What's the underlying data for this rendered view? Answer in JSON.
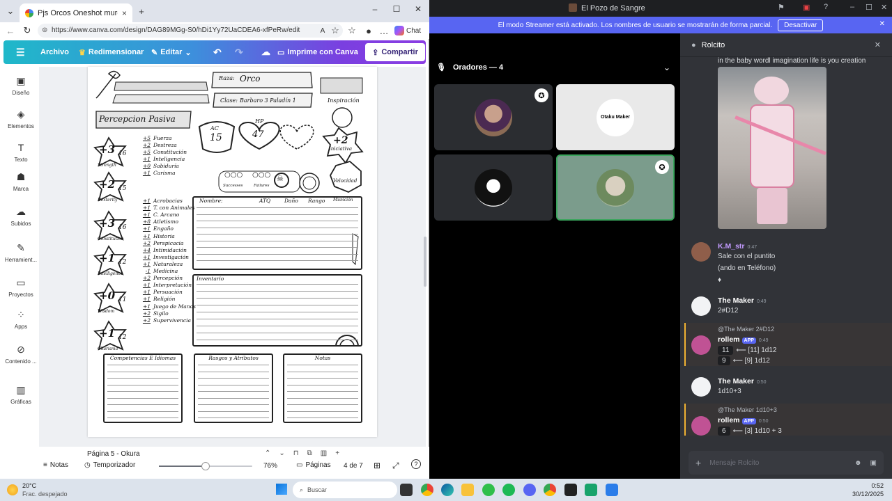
{
  "browser": {
    "tab_title": "Pjs Orcos Oneshot murder hobo -",
    "tab_close": "×",
    "new_tab": "+",
    "url": "https://www.canva.com/design/DAG89MGg-S0/hDi1Yy72UaCDEA6-xfPeRw/edit",
    "chat_label": "Chat"
  },
  "canva_toolbar": {
    "menu": "☰",
    "archivo": "Archivo",
    "redimensionar": "Redimensionar",
    "editar": "Editar",
    "imprime": "Imprime con Canva",
    "compartir": "Compartir"
  },
  "left_rail": [
    {
      "label": "Diseño",
      "icon": "▣"
    },
    {
      "label": "Elementos",
      "icon": "◈"
    },
    {
      "label": "Texto",
      "icon": "T"
    },
    {
      "label": "Marca",
      "icon": "☗"
    },
    {
      "label": "Subidos",
      "icon": "☁"
    },
    {
      "label": "Herramient...",
      "icon": "✎"
    },
    {
      "label": "Proyectos",
      "icon": "▭"
    },
    {
      "label": "Apps",
      "icon": "⁘"
    },
    {
      "label": "Contenido ...",
      "icon": "⊘"
    },
    {
      "label": "Gráficas",
      "icon": "▥"
    }
  ],
  "sheet": {
    "raza_label": "Raza:",
    "raza": "Orco",
    "clase_label": "Clase:",
    "clase": "Barbaro 3 Paladín 1",
    "inspiracion": "Inspiración",
    "percepcion": "Percepcion Pasiva",
    "ac_label": "AC",
    "ac": "15",
    "hp_label": "HP",
    "hp": "47",
    "iniciativa_val": "+2",
    "iniciativa": "Iniciativa",
    "velocidad": "Velocidad",
    "successes": "Successes",
    "failures": "Failures",
    "stats": [
      {
        "mod": "+3",
        "val": "16",
        "name": "Strength"
      },
      {
        "mod": "+2",
        "val": "15",
        "name": "Dexterity"
      },
      {
        "mod": "+3",
        "val": "16",
        "name": "Constitution"
      },
      {
        "mod": "+1",
        "val": "12",
        "name": "Intelligence"
      },
      {
        "mod": "+0",
        "val": "11",
        "name": "Wisdom"
      },
      {
        "mod": "+1",
        "val": "12",
        "name": "Charisma"
      }
    ],
    "saves": [
      {
        "v": "+5",
        "n": "Fuerza"
      },
      {
        "v": "+2",
        "n": "Destreza"
      },
      {
        "v": "+5",
        "n": "Constitución"
      },
      {
        "v": "+1",
        "n": "Inteligencia"
      },
      {
        "v": "+0",
        "n": "Sabiduría"
      },
      {
        "v": "+1",
        "n": "Carisma"
      }
    ],
    "skills": [
      {
        "v": "+1",
        "n": "Acrobacias"
      },
      {
        "v": "+1",
        "n": "T. con Animales"
      },
      {
        "v": "+1",
        "n": "C. Arcano"
      },
      {
        "v": "+8",
        "n": "Atletismo"
      },
      {
        "v": "+1",
        "n": "Engaño"
      },
      {
        "v": "+1",
        "n": "Historia"
      },
      {
        "v": "+2",
        "n": "Perspicacia"
      },
      {
        "v": "+4",
        "n": "Intimidación"
      },
      {
        "v": "+1",
        "n": "Investigación"
      },
      {
        "v": "+1",
        "n": "Naturaleza"
      },
      {
        "v": "-1",
        "n": "Medicina"
      },
      {
        "v": "+2",
        "n": "Percepción"
      },
      {
        "v": "+1",
        "n": "Interpretación"
      },
      {
        "v": "+1",
        "n": "Persuación"
      },
      {
        "v": "+1",
        "n": "Religión"
      },
      {
        "v": "+1",
        "n": "Juego de Manos"
      },
      {
        "v": "+2",
        "n": "Sigilo"
      },
      {
        "v": "+2",
        "n": "Supervivencia"
      }
    ],
    "attack_cols": [
      "Nombre:",
      "ATQ",
      "Daño",
      "Rango",
      "Munición"
    ],
    "inventario": "Inventario",
    "bottom_boxes": [
      "Competencias E Idiomas",
      "Rasgos y Atributos",
      "Notas"
    ]
  },
  "status_bar": {
    "page_label": "Página 5 - Okura",
    "notas": "Notas",
    "temporizador": "Temporizador",
    "zoom": "76%",
    "zoom_fraction": 0.5,
    "paginas": "Páginas",
    "page_count": "4 de 7",
    "help": "?"
  },
  "discord": {
    "window_title": "El Pozo de Sangre",
    "streamer_notice": "El modo Streamer está activado. Los nombres de usuario se mostrarán de forma parcial.",
    "desactivar": "Desactivar",
    "voice_header": "Oradores — 4",
    "otaku_label": "Otaku Maker",
    "thread_title": "Rolcito",
    "caption": "in the baby wordl imagination life is you creation",
    "messages": [
      {
        "name": "K.M_str",
        "time": "0:47",
        "lines": [
          "Sale con el puntito",
          "(ando en Teléfono)",
          "♦"
        ]
      },
      {
        "name": "The Maker",
        "time": "0:49",
        "lines": [
          "2#D12"
        ]
      },
      {
        "reply": "@The Maker 2#D12",
        "name": "rollem",
        "tag": "APP",
        "time": "0:49",
        "rolls": [
          {
            "n": "11",
            "t": "⟵ [11] 1d12"
          },
          {
            "n": "9",
            "t": "⟵ [9] 1d12"
          }
        ]
      },
      {
        "name": "The Maker",
        "time": "0:50",
        "lines": [
          "1d10+3"
        ]
      },
      {
        "reply": "@The Maker 1d10+3",
        "name": "rollem",
        "tag": "APP",
        "time": "0:50",
        "rolls": [
          {
            "n": "6",
            "t": "⟵ [3] 1d10 + 3"
          }
        ]
      }
    ],
    "compose_placeholder": "Mensaje Rolcito"
  },
  "taskbar": {
    "weather_temp": "20°C",
    "weather_desc": "Frac. despejado",
    "search": "Buscar",
    "time": "0:52",
    "date": "30/12/2025"
  },
  "colors": {
    "discord_accent": "#5865f2",
    "speaking_green": "#3ba55d",
    "canva_gradient_start": "#1fb8c9",
    "canva_gradient_end": "#8b3de3"
  }
}
